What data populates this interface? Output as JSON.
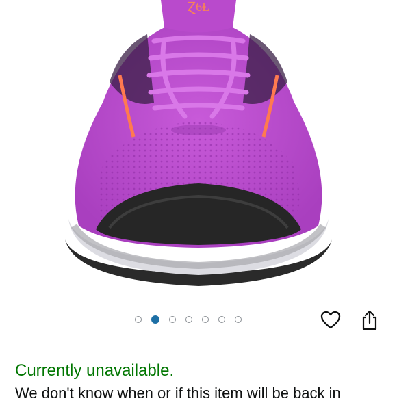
{
  "product_image": {
    "icon": "product-photo",
    "shoe_upper_color": "#c44fd6",
    "accent_color": "#ff7a50",
    "midsole_color": "#e6e6ea",
    "outsole_color": "#262626"
  },
  "carousel": {
    "count": 7,
    "active_index": 1,
    "active_color": "#1d6fa5"
  },
  "actions": {
    "favorite_icon": "heart-icon",
    "share_icon": "share-icon"
  },
  "availability": {
    "status": "Currently unavailable.",
    "status_color": "#007600",
    "detail": "We don't know when or if this item will be back in"
  }
}
